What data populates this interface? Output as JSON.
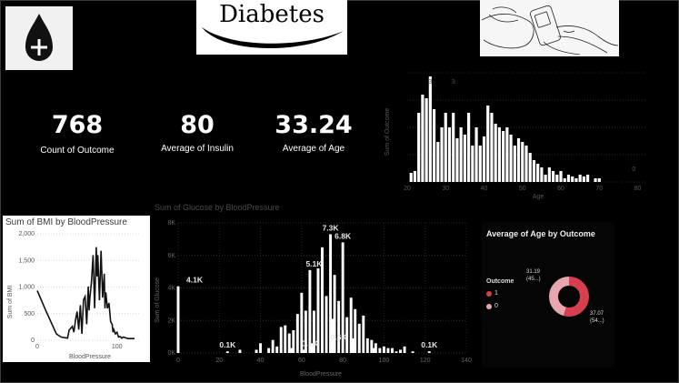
{
  "header": {
    "title": "Diabetes"
  },
  "kpis": [
    {
      "value": "768",
      "label": "Count of Outcome"
    },
    {
      "value": "80",
      "label": "Average of Insulin"
    },
    {
      "value": "33.24",
      "label": "Average of Age"
    }
  ],
  "colors": {
    "background": "#000000",
    "bar": "#ffffff",
    "outcome_1": "#d6404e",
    "outcome_0": "#e8a6ae"
  },
  "chart_data": [
    {
      "type": "bar",
      "title": "",
      "xlabel": "Age",
      "ylabel": "Sum of Outcome",
      "x_ticks": [
        20,
        30,
        40,
        50,
        60,
        70,
        80
      ],
      "xlim": [
        20,
        82
      ],
      "ylim": [
        0,
        60
      ],
      "grid": true,
      "data_labels": [
        "3",
        "3",
        "0"
      ],
      "x": [
        21,
        22,
        23,
        24,
        25,
        26,
        27,
        28,
        29,
        30,
        31,
        32,
        33,
        34,
        35,
        36,
        37,
        38,
        39,
        40,
        41,
        42,
        43,
        44,
        45,
        46,
        47,
        48,
        49,
        50,
        51,
        52,
        53,
        54,
        55,
        56,
        57,
        58,
        59,
        60,
        61,
        62,
        63,
        64,
        65,
        66,
        67,
        69,
        70
      ],
      "values": [
        5,
        6,
        38,
        48,
        46,
        58,
        40,
        22,
        30,
        38,
        30,
        38,
        24,
        30,
        26,
        38,
        20,
        30,
        20,
        25,
        42,
        38,
        32,
        30,
        28,
        30,
        26,
        20,
        24,
        22,
        20,
        16,
        12,
        10,
        8,
        4,
        8,
        6,
        4,
        6,
        2,
        4,
        3,
        2,
        4,
        3,
        4,
        2,
        2
      ]
    },
    {
      "type": "line",
      "title": "Sum of BMI by BloodPressure",
      "xlabel": "BloodPressure",
      "ylabel": "Sum of BMI",
      "y_ticks": [
        "0",
        "500",
        "1,000",
        "1,500",
        "2,000"
      ],
      "x_ticks": [
        0,
        100
      ],
      "xlim": [
        0,
        130
      ],
      "ylim": [
        0,
        2000
      ],
      "grid": true,
      "x": [
        0,
        10,
        24,
        30,
        38,
        40,
        44,
        46,
        48,
        50,
        52,
        54,
        56,
        58,
        60,
        62,
        64,
        65,
        66,
        68,
        70,
        72,
        74,
        75,
        76,
        78,
        80,
        82,
        84,
        85,
        86,
        88,
        90,
        92,
        94,
        95,
        96,
        98,
        100,
        102,
        104,
        106,
        108,
        110,
        114,
        122
      ],
      "values": [
        932,
        580,
        120,
        60,
        40,
        190,
        260,
        150,
        380,
        540,
        200,
        660,
        120,
        760,
        820,
        300,
        1010,
        560,
        800,
        1090,
        1600,
        600,
        1750,
        1200,
        1600,
        750,
        1680,
        800,
        1250,
        600,
        900,
        600,
        700,
        350,
        300,
        150,
        200,
        120,
        150,
        60,
        70,
        40,
        60,
        50,
        30,
        30
      ]
    },
    {
      "type": "bar",
      "title": "Sum of Glucose by BloodPressure",
      "xlabel": "BloodPressure",
      "ylabel": "Sum of Glucose",
      "y_ticks": [
        "0K",
        "2K",
        "4K",
        "6K",
        "8K"
      ],
      "x_ticks": [
        0,
        20,
        40,
        60,
        80,
        100,
        120,
        140
      ],
      "xlim": [
        0,
        140
      ],
      "ylim": [
        0,
        8000
      ],
      "grid": true,
      "data_labels": [
        "4.1K",
        "0.1K",
        "7.3K",
        "5.1K",
        "6.8K",
        "0.1K",
        "0.6K",
        "0.1K"
      ],
      "x": [
        0,
        24,
        30,
        38,
        40,
        44,
        46,
        48,
        50,
        52,
        54,
        55,
        56,
        58,
        60,
        61,
        62,
        64,
        65,
        66,
        68,
        70,
        72,
        74,
        75,
        76,
        78,
        80,
        82,
        84,
        85,
        86,
        88,
        90,
        92,
        94,
        95,
        96,
        98,
        100,
        102,
        104,
        106,
        108,
        110,
        114,
        122
      ],
      "values": [
        4100,
        100,
        200,
        200,
        600,
        300,
        800,
        400,
        1600,
        1700,
        1200,
        300,
        1400,
        2400,
        3700,
        200,
        2600,
        5100,
        600,
        2600,
        5200,
        6500,
        3500,
        7300,
        2100,
        4800,
        3200,
        6800,
        2200,
        3400,
        900,
        2700,
        1800,
        2300,
        900,
        800,
        300,
        600,
        300,
        400,
        300,
        300,
        100,
        200,
        400,
        100,
        100
      ]
    },
    {
      "type": "pie",
      "title": "Average of Age by Outcome",
      "legend_title": "Outcome",
      "legend_position": "left",
      "labels": [
        "1",
        "0"
      ],
      "values": [
        37.07,
        31.19
      ],
      "slice_labels": [
        {
          "value": "37.07",
          "share": "(54...)"
        },
        {
          "value": "31.19",
          "share": "(45...)"
        }
      ]
    }
  ]
}
